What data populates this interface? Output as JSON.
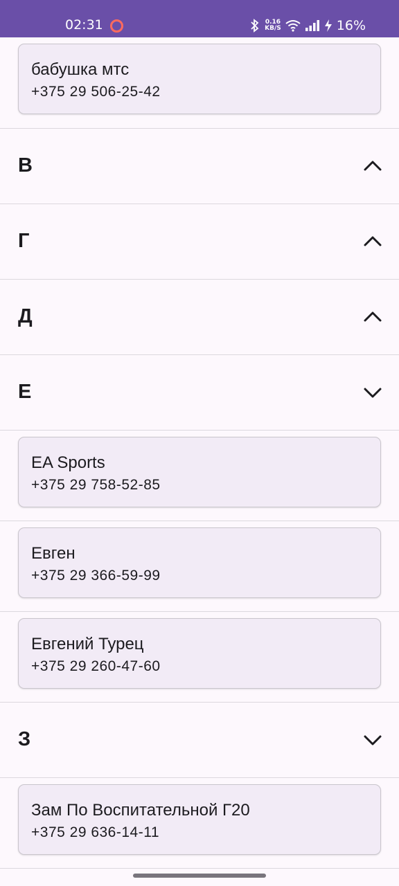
{
  "status_bar": {
    "time": "02:31",
    "net_speed_value": "0.16",
    "net_speed_unit": "KB/S",
    "battery": "16%"
  },
  "contacts_group_b_tail": [
    {
      "name": "бабушка мтс",
      "phone": "+375 29 506-25-42"
    }
  ],
  "sections": [
    {
      "letter": "В",
      "expanded": false
    },
    {
      "letter": "Г",
      "expanded": false
    },
    {
      "letter": "Д",
      "expanded": false
    },
    {
      "letter": "Е",
      "expanded": true
    },
    {
      "letter": "З",
      "expanded": true
    }
  ],
  "contacts_e": [
    {
      "name": "EA Sports",
      "phone": "+375 29 758-52-85"
    },
    {
      "name": "Евген",
      "phone": "+375 29 366-59-99"
    },
    {
      "name": "Евгений Турец",
      "phone": "+375 29 260-47-60"
    }
  ],
  "contacts_z": [
    {
      "name": "Зам По Воспитательной Г20",
      "phone": "+375 29 636-14-11"
    }
  ],
  "icons": {
    "collapsed": "chevron-up-icon",
    "expanded": "chevron-down-icon"
  },
  "colors": {
    "status_bar": "#6a4fa8",
    "background": "#fdf8fd",
    "card": "#f2ebf6",
    "divider": "#dcd8de"
  }
}
